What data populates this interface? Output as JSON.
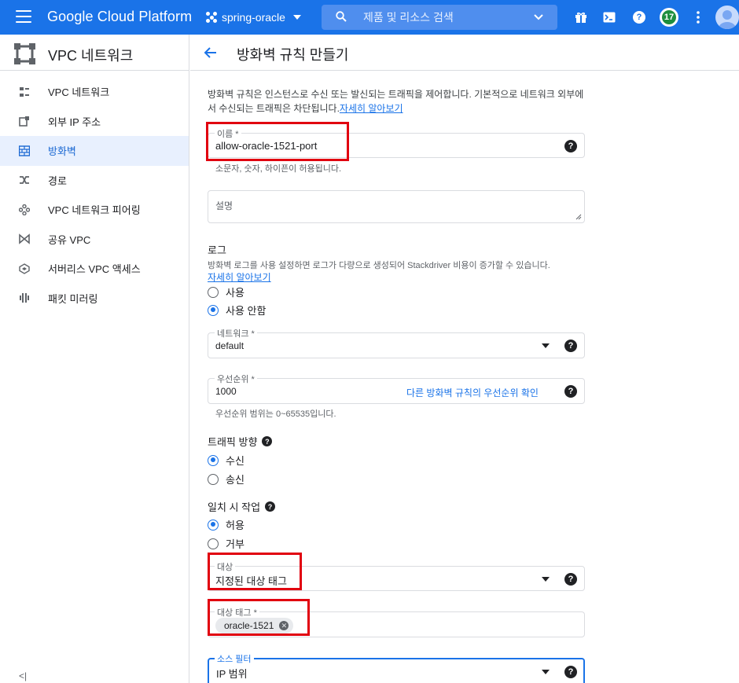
{
  "topbar": {
    "brand": "Google Cloud Platform",
    "project": "spring-oracle",
    "search_placeholder": "제품 및 리소스 검색",
    "notification_count": "17",
    "help_glyph": "?"
  },
  "sidebar": {
    "title": "VPC 네트워크",
    "items": [
      {
        "label": "VPC 네트워크",
        "icon": "vpc-network-icon"
      },
      {
        "label": "외부 IP 주소",
        "icon": "external-ip-icon"
      },
      {
        "label": "방화벽",
        "icon": "firewall-icon",
        "active": true
      },
      {
        "label": "경로",
        "icon": "routes-icon"
      },
      {
        "label": "VPC 네트워크 피어링",
        "icon": "peering-icon"
      },
      {
        "label": "공유 VPC",
        "icon": "shared-vpc-icon"
      },
      {
        "label": "서버리스 VPC 액세스",
        "icon": "serverless-icon"
      },
      {
        "label": "패킷 미러링",
        "icon": "packet-mirroring-icon"
      }
    ],
    "collapse_label": "<|"
  },
  "page": {
    "title": "방화벽 규칙 만들기",
    "intro": "방화벽 규칙은 인스턴스로 수신 또는 발신되는 트래픽을 제어합니다. 기본적으로 네트워크 외부에서 수신되는 트래픽은 차단됩니다.",
    "intro_link": "자세히 알아보기"
  },
  "form": {
    "name": {
      "label": "이름 *",
      "value": "allow-oracle-1521-port",
      "hint": "소문자, 숫자, 하이픈이 허용됩니다."
    },
    "description": {
      "placeholder": "설명"
    },
    "logs": {
      "title": "로그",
      "desc": "방화벽 로그를 사용 설정하면 로그가 다량으로 생성되어 Stackdriver 비용이 증가할 수 있습니다.",
      "link": "자세히 알아보기",
      "options": [
        "사용",
        "사용 안함"
      ],
      "selected": "사용 안함"
    },
    "network": {
      "label": "네트워크 *",
      "value": "default"
    },
    "priority": {
      "label": "우선순위 *",
      "value": "1000",
      "link": "다른 방화벽 규칙의 우선순위 확인",
      "hint": "우선순위 범위는 0~65535입니다."
    },
    "direction": {
      "title": "트래픽 방향",
      "options": [
        "수신",
        "송신"
      ],
      "selected": "수신"
    },
    "action": {
      "title": "일치 시 작업",
      "options": [
        "허용",
        "거부"
      ],
      "selected": "허용"
    },
    "targets": {
      "label": "대상",
      "value": "지정된 대상 태그"
    },
    "target_tags": {
      "label": "대상 태그 *",
      "chip": "oracle-1521",
      "chip_remove": "✕"
    },
    "source_filter": {
      "label": "소스 필터",
      "value": "IP 범위"
    }
  },
  "colors": {
    "brand_blue": "#1a73e8",
    "highlight_red": "#e1000f",
    "active_bg": "#e8f0fe"
  }
}
